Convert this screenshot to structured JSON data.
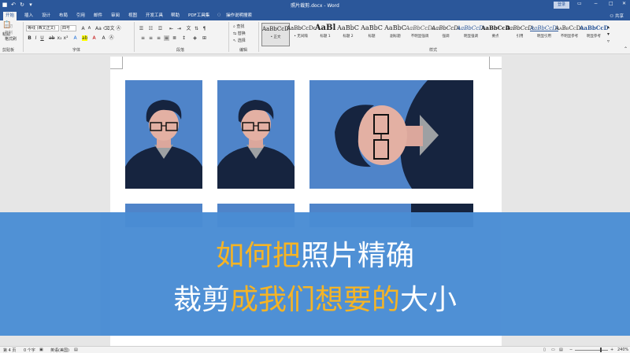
{
  "titlebar": {
    "doc_title": "照片裁剪.docx - Word",
    "login": "登录",
    "min": "−",
    "restore": "□",
    "close": "✕",
    "ribbon_opts": "▭"
  },
  "tabs": [
    {
      "label": "开始",
      "active": true
    },
    {
      "label": "插入"
    },
    {
      "label": "设计"
    },
    {
      "label": "布局"
    },
    {
      "label": "引用"
    },
    {
      "label": "邮件"
    },
    {
      "label": "审阅"
    },
    {
      "label": "视图"
    },
    {
      "label": "开发工具"
    },
    {
      "label": "帮助"
    },
    {
      "label": "PDF工具集"
    },
    {
      "label": "操作说明搜索"
    }
  ],
  "share": "共享",
  "clipboard": {
    "paste": "粘贴",
    "cut": "剪切",
    "copy": "复制",
    "format_painter": "格式刷",
    "label": "剪贴板"
  },
  "font": {
    "name": "等线 (西文正文)",
    "size": "四号",
    "label": "字体"
  },
  "paragraph": {
    "label": "段落"
  },
  "editing": {
    "find": "查找",
    "replace": "替换",
    "select": "选择",
    "label": "编辑"
  },
  "styles": {
    "label": "样式",
    "items": [
      {
        "preview": "AaBbCcDc",
        "name": "• 正文",
        "selected": true
      },
      {
        "preview": "AaBbCcDc",
        "name": "• 无间隔"
      },
      {
        "preview": "AaBl",
        "name": "标题 1"
      },
      {
        "preview": "AaBbC",
        "name": "标题 2"
      },
      {
        "preview": "AaBbC",
        "name": "标题"
      },
      {
        "preview": "AaBbC",
        "name": "副标题"
      },
      {
        "preview": "AaBbCcDc",
        "name": "不明显强调"
      },
      {
        "preview": "AaBbCcDc",
        "name": "强调"
      },
      {
        "preview": "AaBbCcDc",
        "name": "明显强调"
      },
      {
        "preview": "AaBbCcDc",
        "name": "要点"
      },
      {
        "preview": "AaBbCcDc",
        "name": "引用"
      },
      {
        "preview": "AaBbCcDc",
        "name": "明显引用"
      },
      {
        "preview": "AaBbCcDc",
        "name": "不明显参考"
      },
      {
        "preview": "AaBbCcDc",
        "name": "明显参考"
      }
    ]
  },
  "banner": {
    "line1_highlight": "如何把",
    "line1_rest": "照片精确",
    "line2_a": "裁剪",
    "line2_b": "成我们想要的",
    "line2_c": "大小"
  },
  "statusbar": {
    "page": "第 4 页",
    "words": "0 个字",
    "lang": "英语(美国)",
    "zoom": "240%"
  },
  "colors": {
    "accent": "#2b579a",
    "banner": "#4a8dd4",
    "highlight": "#f5b21e",
    "photo_bg": "#4f84c9"
  }
}
